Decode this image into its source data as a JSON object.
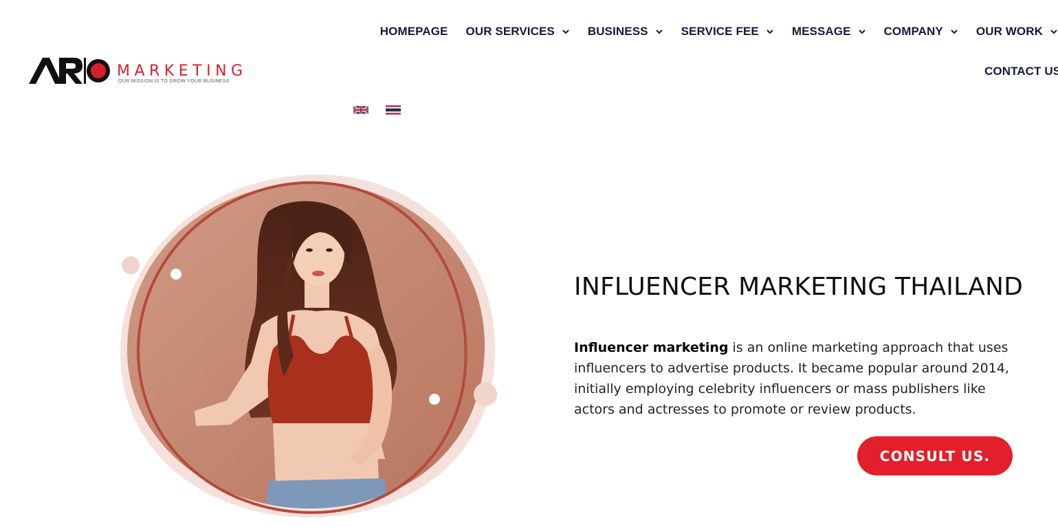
{
  "logo": {
    "brand": "MARKETING",
    "tagline": "OUR MISSION IS TO GROW YOUR BUSINESS",
    "accent_color": "#d7202a"
  },
  "nav": {
    "items": [
      {
        "label": "HOMEPAGE",
        "has_dropdown": false
      },
      {
        "label": "OUR SERVICES",
        "has_dropdown": true
      },
      {
        "label": "BUSINESS",
        "has_dropdown": true
      },
      {
        "label": "SERVICE FEE",
        "has_dropdown": true
      },
      {
        "label": "MESSAGE",
        "has_dropdown": true
      },
      {
        "label": "COMPANY",
        "has_dropdown": true
      },
      {
        "label": "OUR WORK",
        "has_dropdown": true
      }
    ],
    "second_row": {
      "label": "CONTACT US"
    },
    "color": "#14183d"
  },
  "languages": [
    {
      "icon": "uk-flag-icon"
    },
    {
      "icon": "thai-flag-icon"
    }
  ],
  "hero": {
    "title": "INFLUENCER MARKETING THAILAND",
    "lead_bold": "Influencer marketing",
    "lead_rest": " is an online marketing approach that uses influencers to advertise products. It became popular around 2014, initially employing celebrity influencers or mass publishers like actors and actresses to promote or review products.",
    "cta_label": "CONSULT US.",
    "cta_color": "#e21f2b"
  }
}
